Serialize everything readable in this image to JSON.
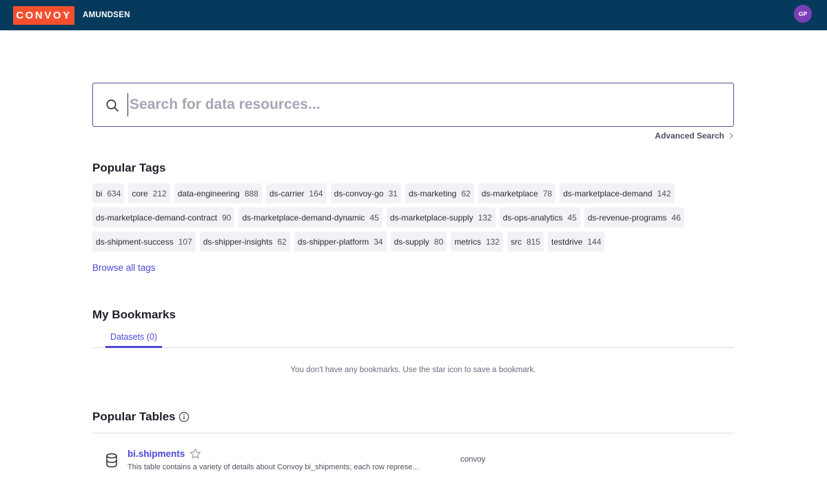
{
  "header": {
    "logo_text": "CONVOY",
    "app_name": "AMUNDSEN",
    "avatar_initials": "GP",
    "logo_color": "#f4502f",
    "bar_color": "#063a5c",
    "avatar_color": "#7b3fb5"
  },
  "search": {
    "placeholder": "Search for data resources...",
    "advanced_label": "Advanced Search"
  },
  "popular_tags": {
    "title": "Popular Tags",
    "browse_all_label": "Browse all tags",
    "items": [
      {
        "name": "bi",
        "count": "634"
      },
      {
        "name": "core",
        "count": "212"
      },
      {
        "name": "data-engineering",
        "count": "888"
      },
      {
        "name": "ds-carrier",
        "count": "164"
      },
      {
        "name": "ds-convoy-go",
        "count": "31"
      },
      {
        "name": "ds-marketing",
        "count": "62"
      },
      {
        "name": "ds-marketplace",
        "count": "78"
      },
      {
        "name": "ds-marketplace-demand",
        "count": "142"
      },
      {
        "name": "ds-marketplace-demand-contract",
        "count": "90"
      },
      {
        "name": "ds-marketplace-demand-dynamic",
        "count": "45"
      },
      {
        "name": "ds-marketplace-supply",
        "count": "132"
      },
      {
        "name": "ds-ops-analytics",
        "count": "45"
      },
      {
        "name": "ds-revenue-programs",
        "count": "46"
      },
      {
        "name": "ds-shipment-success",
        "count": "107"
      },
      {
        "name": "ds-shipper-insights",
        "count": "62"
      },
      {
        "name": "ds-shipper-platform",
        "count": "34"
      },
      {
        "name": "ds-supply",
        "count": "80"
      },
      {
        "name": "metrics",
        "count": "132"
      },
      {
        "name": "src",
        "count": "815"
      },
      {
        "name": "testdrive",
        "count": "144"
      }
    ]
  },
  "bookmarks": {
    "title": "My Bookmarks",
    "tab_label": "Datasets (0)",
    "empty_message": "You don't have any bookmarks. Use the star icon to save a bookmark."
  },
  "popular_tables": {
    "title": "Popular Tables",
    "rows": [
      {
        "name": "bi.shipments",
        "description": "This table contains a variety of details about Convoy bi_shipments; each row represe...",
        "source": "convoy"
      }
    ]
  },
  "accent_color": "#4c49d8"
}
